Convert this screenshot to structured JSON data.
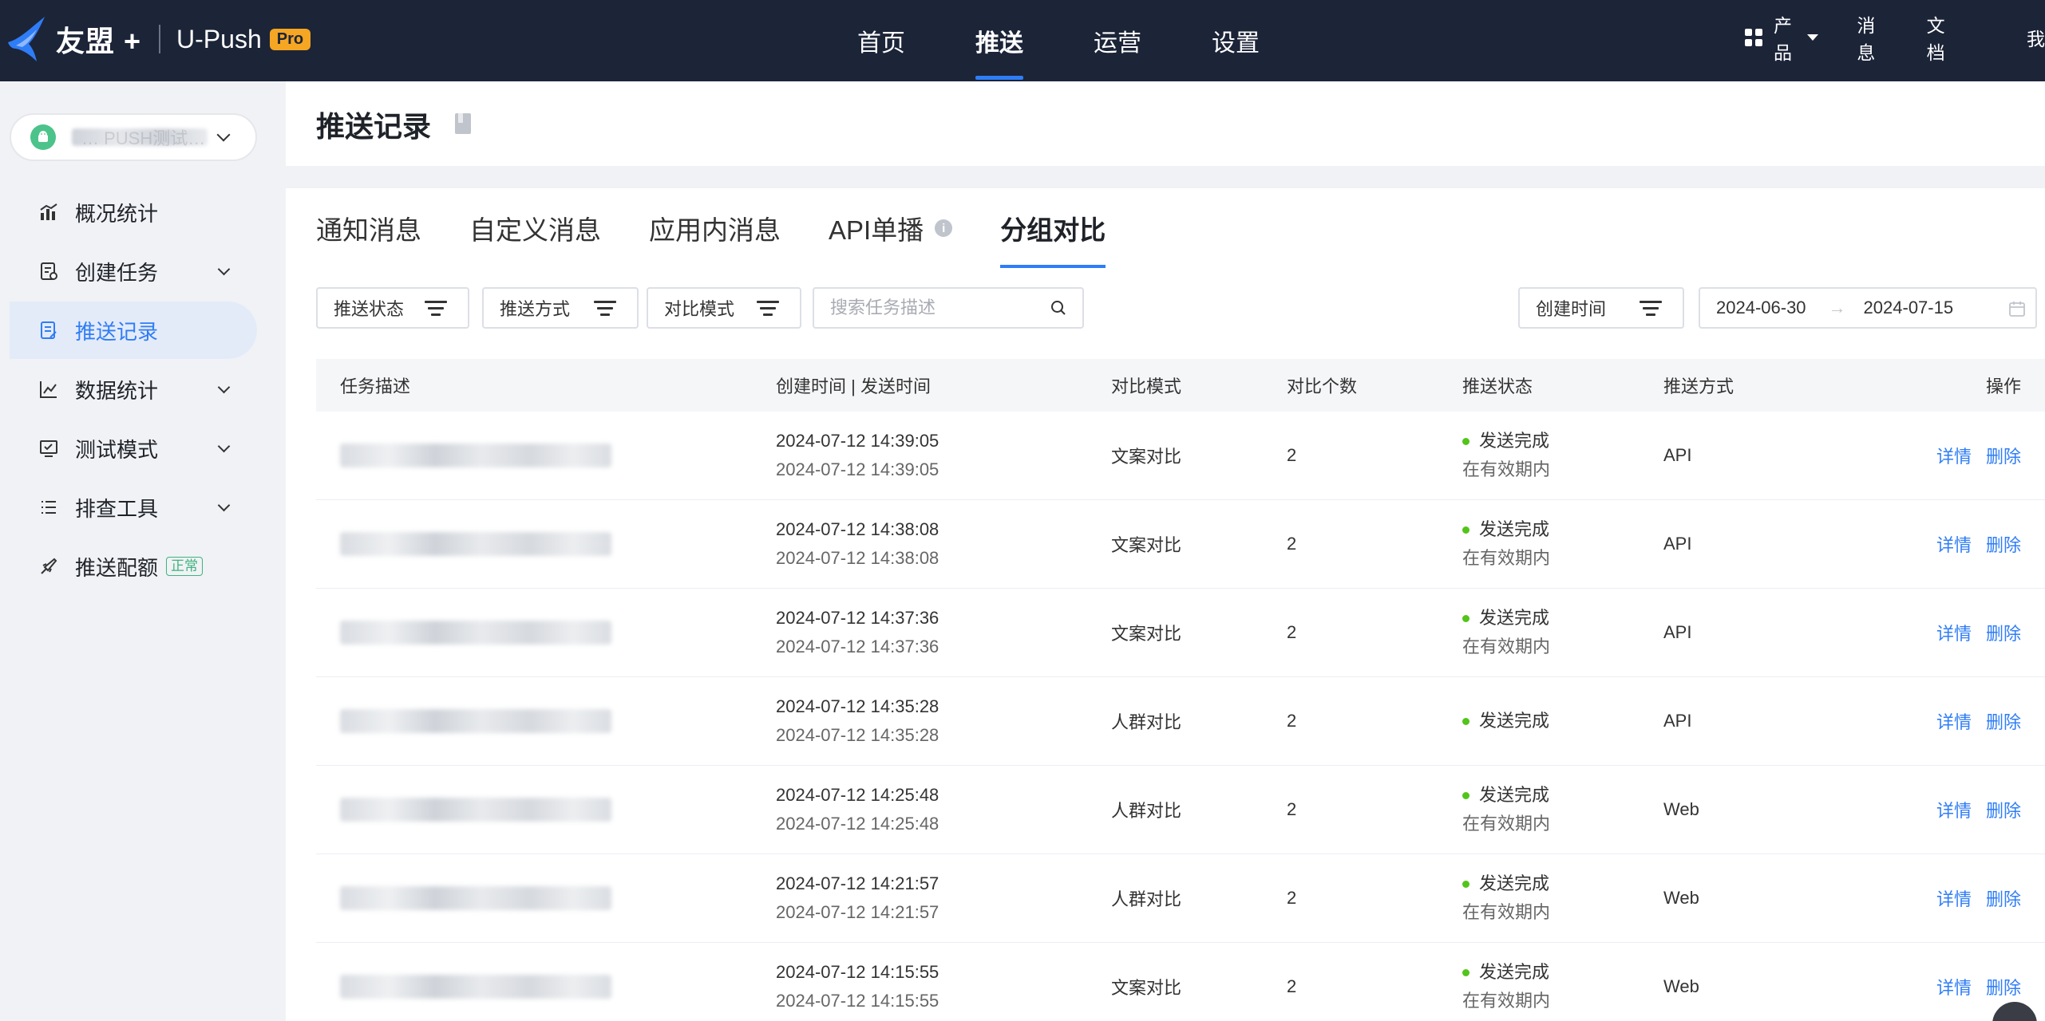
{
  "header": {
    "brand": "友盟 +",
    "product": "U-Push",
    "pro_badge": "Pro",
    "nav": [
      "首页",
      "推送",
      "运营",
      "设置"
    ],
    "active_nav": 1,
    "right": {
      "product_menu": "产品",
      "messages": "消息",
      "docs": "文档",
      "me": "我"
    }
  },
  "sidebar": {
    "app_name": "… PUSH测试…",
    "items": [
      {
        "label": "概况统计",
        "icon": "chart-icon",
        "expandable": false
      },
      {
        "label": "创建任务",
        "icon": "task-icon",
        "expandable": true
      },
      {
        "label": "推送记录",
        "icon": "record-icon",
        "expandable": false,
        "active": true
      },
      {
        "label": "数据统计",
        "icon": "stats-icon",
        "expandable": true
      },
      {
        "label": "测试模式",
        "icon": "test-icon",
        "expandable": true
      },
      {
        "label": "排查工具",
        "icon": "tools-icon",
        "expandable": true
      },
      {
        "label": "推送配额",
        "icon": "quota-icon",
        "expandable": false,
        "badge": "正常"
      }
    ]
  },
  "page": {
    "title": "推送记录"
  },
  "tabs": [
    {
      "label": "通知消息"
    },
    {
      "label": "自定义消息"
    },
    {
      "label": "应用内消息"
    },
    {
      "label": "API单播",
      "info": "i"
    },
    {
      "label": "分组对比",
      "active": true
    }
  ],
  "filters": {
    "status": "推送状态",
    "method": "推送方式",
    "compare_mode": "对比模式",
    "search_placeholder": "搜索任务描述",
    "created_time": "创建时间",
    "date_start": "2024-06-30",
    "date_arrow": "→",
    "date_end": "2024-07-15"
  },
  "table": {
    "columns": [
      "任务描述",
      "创建时间 | 发送时间",
      "对比模式",
      "对比个数",
      "推送状态",
      "推送方式",
      "操作"
    ],
    "actions": {
      "detail": "详情",
      "delete": "删除"
    },
    "rows": [
      {
        "created": "2024-07-12 14:39:05",
        "sent": "2024-07-12 14:39:05",
        "mode": "文案对比",
        "count": "2",
        "status": "发送完成",
        "sub": "在有效期内",
        "method": "API"
      },
      {
        "created": "2024-07-12 14:38:08",
        "sent": "2024-07-12 14:38:08",
        "mode": "文案对比",
        "count": "2",
        "status": "发送完成",
        "sub": "在有效期内",
        "method": "API"
      },
      {
        "created": "2024-07-12 14:37:36",
        "sent": "2024-07-12 14:37:36",
        "mode": "文案对比",
        "count": "2",
        "status": "发送完成",
        "sub": "在有效期内",
        "method": "API"
      },
      {
        "created": "2024-07-12 14:35:28",
        "sent": "2024-07-12 14:35:28",
        "mode": "人群对比",
        "count": "2",
        "status": "发送完成",
        "sub": "",
        "method": "API"
      },
      {
        "created": "2024-07-12 14:25:48",
        "sent": "2024-07-12 14:25:48",
        "mode": "人群对比",
        "count": "2",
        "status": "发送完成",
        "sub": "在有效期内",
        "method": "Web"
      },
      {
        "created": "2024-07-12 14:21:57",
        "sent": "2024-07-12 14:21:57",
        "mode": "人群对比",
        "count": "2",
        "status": "发送完成",
        "sub": "在有效期内",
        "method": "Web"
      },
      {
        "created": "2024-07-12 14:15:55",
        "sent": "2024-07-12 14:15:55",
        "mode": "文案对比",
        "count": "2",
        "status": "发送完成",
        "sub": "在有效期内",
        "method": "Web"
      }
    ]
  },
  "colors": {
    "header_bg": "#1c2438",
    "accent": "#2f7df6",
    "success": "#52c41a",
    "pro": "#f5a623"
  }
}
